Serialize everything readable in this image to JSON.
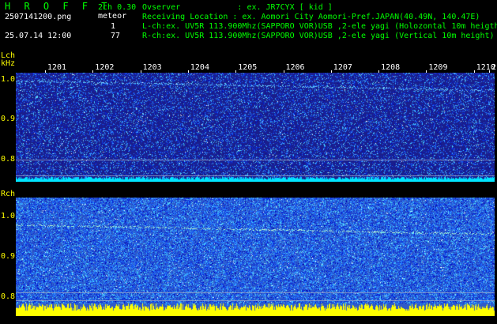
{
  "header": {
    "app_title": "H R O F F T",
    "mode": "2ch 0.30",
    "filename": "2507141200.png",
    "meteor_label": "meteor",
    "datetime": "25.07.14 12:00",
    "lch_count": "1",
    "rch_count": "77",
    "observer": "Ovserver            : ex. JR7CYX [ kid ]",
    "location": "Receiving Location : ex. Aomori City Aomori-Pref.JAPAN(40.49N, 140.47E)",
    "lch_info": "L-ch:ex. UV5R 113.900Mhz(SAPPORO VOR)USB ,2-ele yagi (Holozontal 10m heigth)",
    "rch_info": "R-ch:ex. UV5R 113.900Mhz(SAPPORO VOR)USB ,2-ele yagi (Vertical 10m height)"
  },
  "time_ticks": [
    "1201",
    "1202",
    "1203",
    "1204",
    "1205",
    "1206",
    "1207",
    "1208",
    "1209",
    "1210",
    "2"
  ],
  "lch": {
    "label": "Lch",
    "unit": "kHz",
    "freq_ticks": [
      "1.0",
      "0.9",
      "0.8"
    ]
  },
  "rch": {
    "label": "Rch",
    "freq_ticks": [
      "1.0",
      "0.9",
      "0.8"
    ]
  },
  "colors": {
    "text_green": "#00ff00",
    "axis_yellow": "#ffff00",
    "lch_base": "#1a1e8c",
    "rch_base": "#2f5ac8",
    "lch_floor": "#00e5ff",
    "rch_floor": "#ffff00"
  }
}
